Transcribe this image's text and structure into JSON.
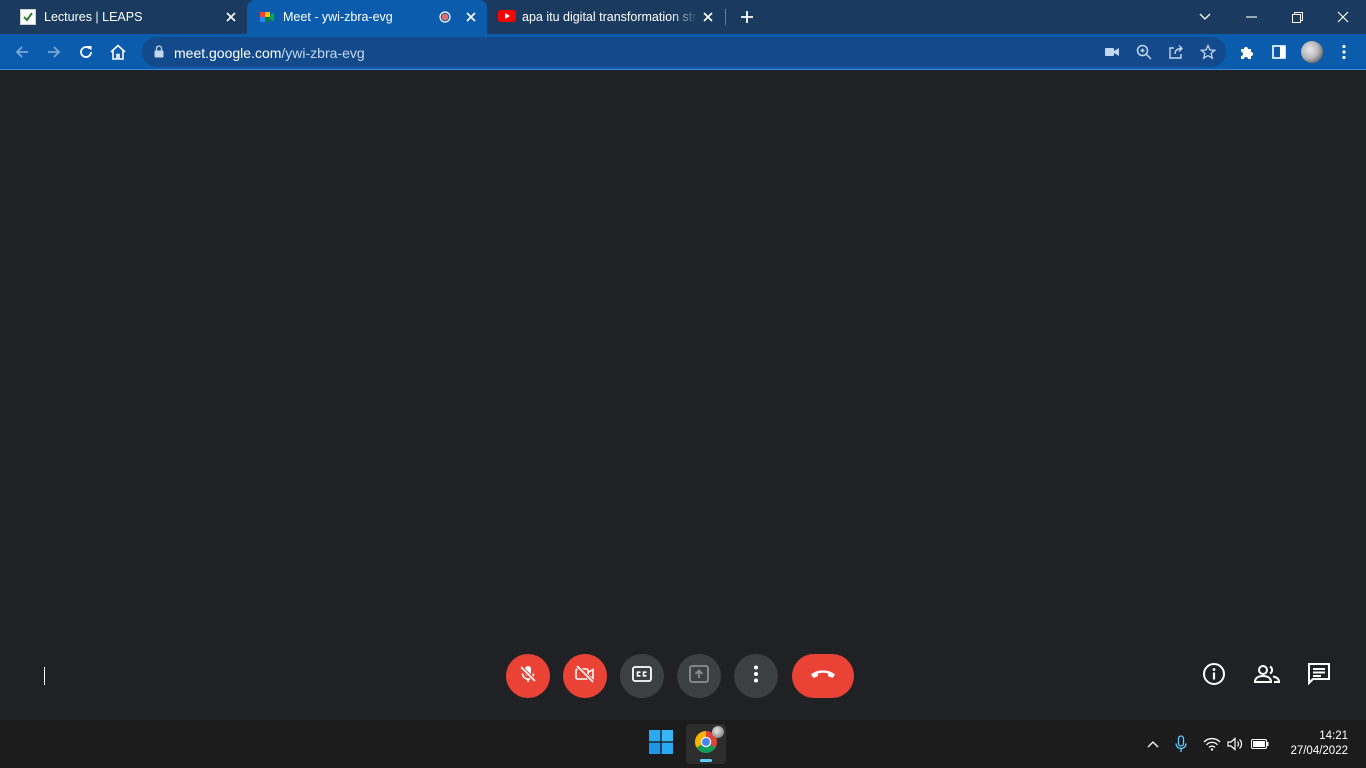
{
  "browser": {
    "tabs": [
      {
        "title": "Lectures | LEAPS",
        "icon": "leaps-favicon",
        "active": false
      },
      {
        "title": "Meet - ywi-zbra-evg",
        "icon": "google-meet-favicon",
        "active": true,
        "recording": true
      },
      {
        "title": "apa itu digital transformation strategy",
        "icon": "youtube-favicon",
        "active": false
      }
    ],
    "url_host": "meet.google.com",
    "url_path": "/ywi-zbra-evg"
  },
  "meet": {
    "controls": [
      {
        "name": "microphone-off",
        "state": "off",
        "color": "#ea4335"
      },
      {
        "name": "camera-off",
        "state": "off",
        "color": "#ea4335"
      },
      {
        "name": "captions",
        "state": "off",
        "color": "#3c4043"
      },
      {
        "name": "present-screen",
        "state": "disabled",
        "color": "#3c4043"
      },
      {
        "name": "more-options",
        "color": "#3c4043"
      },
      {
        "name": "leave-call",
        "color": "#ea4335"
      }
    ],
    "side_buttons": [
      "meeting-details",
      "people",
      "chat"
    ]
  },
  "taskbar": {
    "time": "14:21",
    "date": "27/04/2022"
  },
  "colors": {
    "tab_strip": "#1a3a5f",
    "toolbar": "#0b5cad",
    "meet_background": "#202124",
    "meet_red": "#ea4335",
    "meet_gray": "#3c4043",
    "taskbar": "#1c1c1c"
  }
}
